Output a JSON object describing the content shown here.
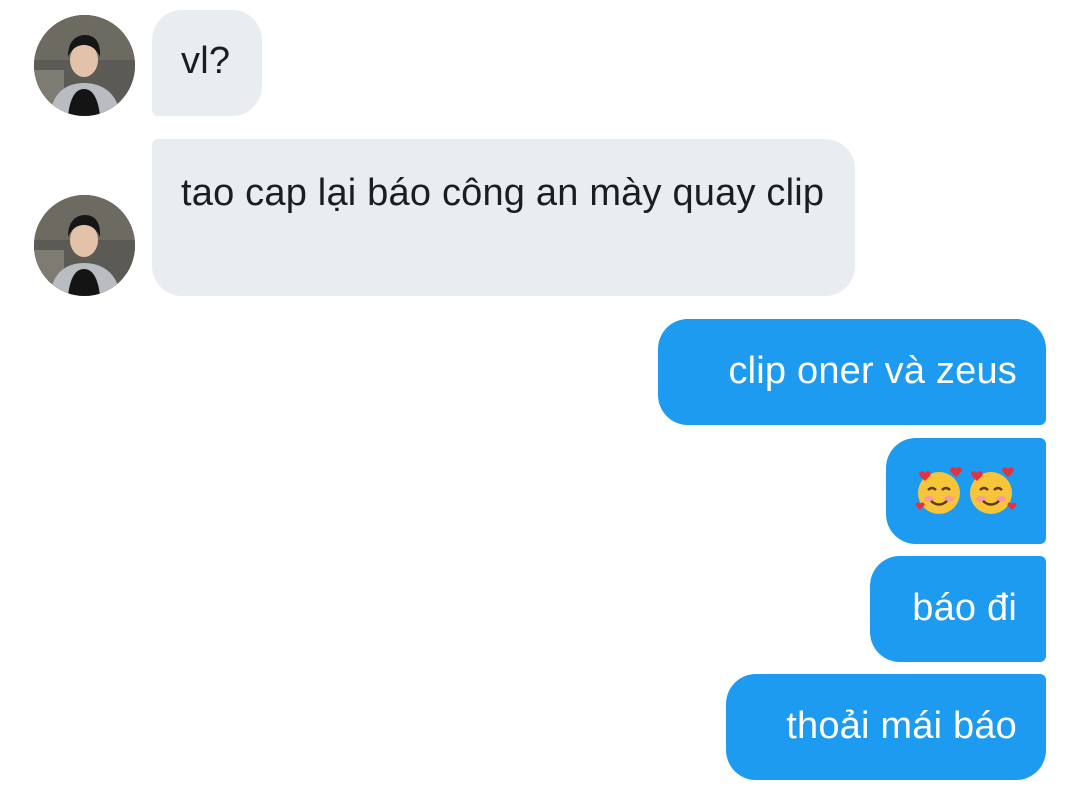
{
  "conversation": {
    "incoming": [
      {
        "text": "vl?",
        "avatar": "contact-avatar"
      },
      {
        "text": "tao cap lại báo công an mày quay clip",
        "avatar": "contact-avatar"
      }
    ],
    "outgoing": [
      {
        "text": "clip oner và zeus"
      },
      {
        "emoji": "🥰🥰",
        "icon": "smiling-face-with-hearts-icon"
      },
      {
        "text": "báo đi"
      },
      {
        "text": "thoải mái báo"
      }
    ]
  },
  "colors": {
    "incoming_bubble": "#e9edf1",
    "outgoing_bubble": "#1d9bf0",
    "incoming_text": "#1b1e21",
    "outgoing_text": "#ffffff"
  }
}
